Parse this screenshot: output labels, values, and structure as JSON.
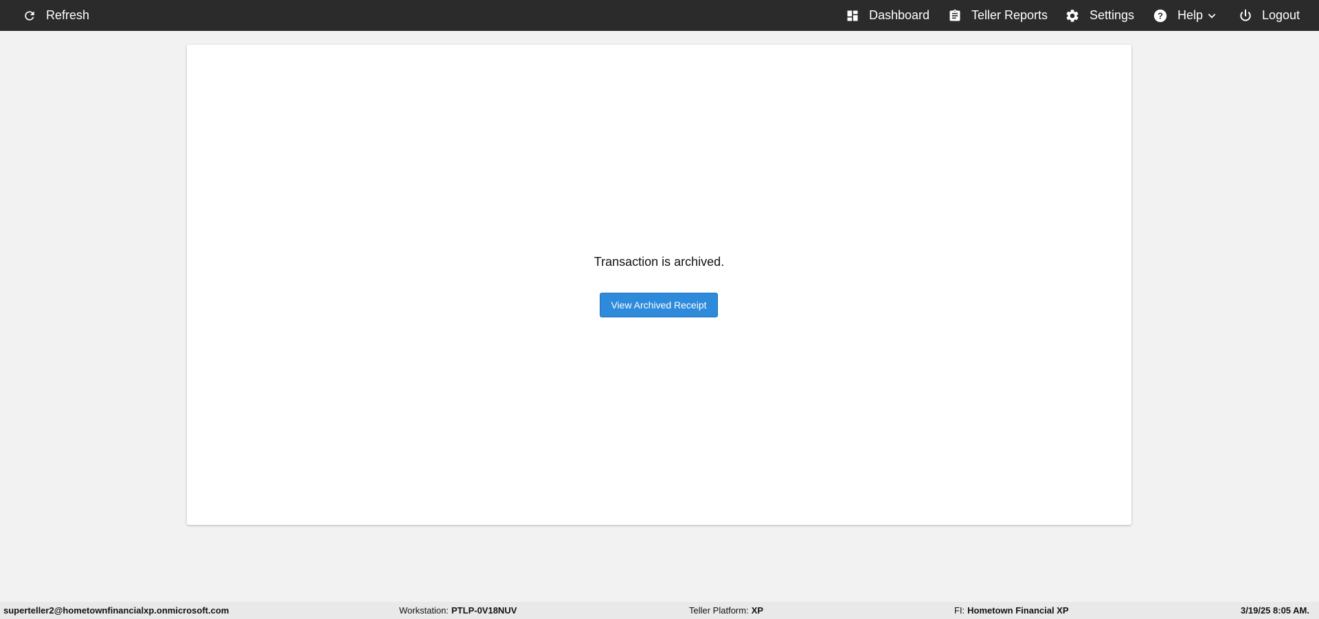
{
  "topbar": {
    "refresh": {
      "label": "Refresh",
      "icon": "refresh-icon"
    },
    "dashboard": {
      "label": "Dashboard",
      "icon": "dashboard-icon"
    },
    "teller_reports": {
      "label": "Teller Reports",
      "icon": "clipboard-icon"
    },
    "settings": {
      "label": "Settings",
      "icon": "gear-icon"
    },
    "help": {
      "label": "Help",
      "icon": "help-icon"
    },
    "logout": {
      "label": "Logout",
      "icon": "power-icon"
    }
  },
  "main": {
    "message": "Transaction is archived.",
    "button_label": "View Archived Receipt",
    "button_color": "#2e8bdc"
  },
  "statusbar": {
    "user": "superteller2@hometownfinancialxp.onmicrosoft.com",
    "workstation_label": "Workstation:",
    "workstation_value": "PTLP-0V18NUV",
    "platform_label": "Teller Platform:",
    "platform_value": "XP",
    "fi_label": "FI:",
    "fi_value": "Hometown Financial XP",
    "datetime": "3/19/25 8:05 AM."
  },
  "colors": {
    "topbar_bg": "#2b2b2b",
    "page_bg": "#f2f2f2",
    "statusbar_bg": "#e9e9e9"
  }
}
